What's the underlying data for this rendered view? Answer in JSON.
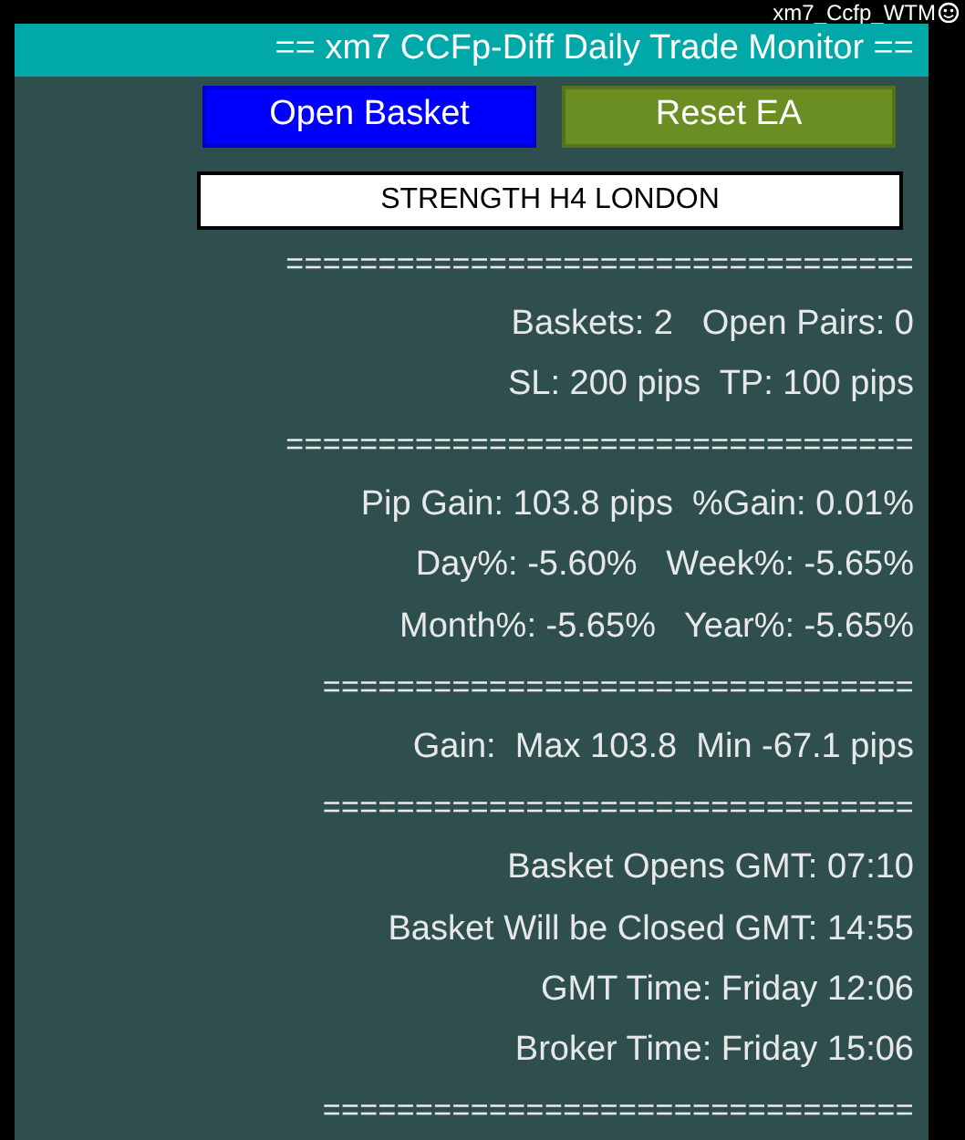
{
  "caption": "xm7_Ccfp_WTM",
  "title": "== xm7 CCFp-Diff Daily Trade Monitor ==",
  "buttons": [
    {
      "label": "Open Basket",
      "color": "#0000ff"
    },
    {
      "label": "Reset EA",
      "color": "#6b8e23"
    }
  ],
  "strategy_label": "STRENGTH H4 LONDON",
  "lines": [
    {
      "kind": "separator",
      "text": "=================================="
    },
    {
      "kind": "text",
      "text": "Baskets: 2   Open Pairs: 0"
    },
    {
      "kind": "text",
      "text": "SL: 200 pips  TP: 100 pips"
    },
    {
      "kind": "separator",
      "text": "=================================="
    },
    {
      "kind": "text",
      "text": "Pip Gain: 103.8 pips  %Gain: 0.01%"
    },
    {
      "kind": "text",
      "text": "Day%: -5.60%   Week%: -5.65%"
    },
    {
      "kind": "text",
      "text": "Month%: -5.65%   Year%: -5.65%"
    },
    {
      "kind": "separator",
      "text": "================================"
    },
    {
      "kind": "text",
      "text": "Gain:  Max 103.8  Min -67.1 pips"
    },
    {
      "kind": "separator",
      "text": "================================"
    },
    {
      "kind": "text",
      "text": "Basket Opens GMT: 07:10"
    },
    {
      "kind": "text",
      "text": "Basket Will be Closed GMT: 14:55"
    },
    {
      "kind": "text",
      "text": "GMT Time: Friday 12:06"
    },
    {
      "kind": "text",
      "text": "Broker Time: Friday 15:06"
    },
    {
      "kind": "separator",
      "text": "================================"
    }
  ]
}
